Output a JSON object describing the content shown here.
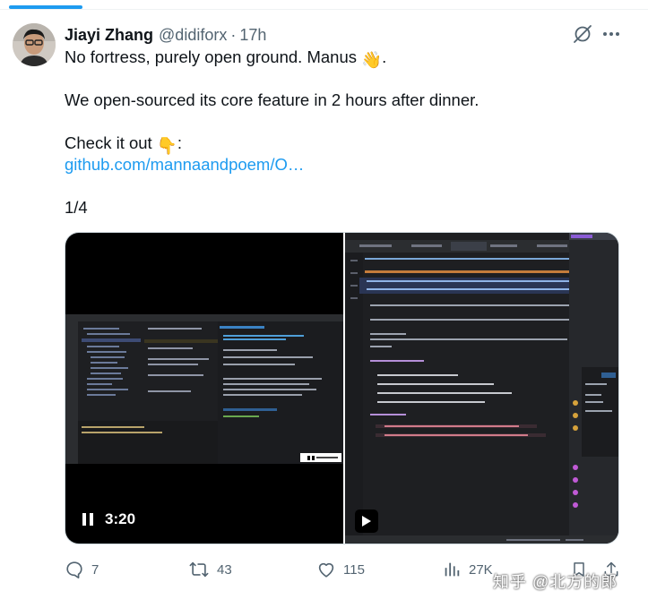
{
  "tweet": {
    "author": {
      "name": "Jiayi Zhang",
      "handle": "@didiforx",
      "separator": "·",
      "time": "17h"
    },
    "lines": {
      "line1_text": "No fortress, purely open ground. Manus ",
      "line1_emoji": "👋",
      "line1_end": ".",
      "line2": "We open-sourced its core feature in 2 hours after dinner.",
      "line3_text": "Check it out ",
      "line3_emoji": "👇",
      "line3_end": ":",
      "link": "github.com/mannaandpoem/O…",
      "counter": "1/4"
    },
    "video": {
      "duration": "3:20"
    },
    "actions": {
      "replies": "7",
      "reposts": "43",
      "likes": "115",
      "views": "27K"
    }
  },
  "icons": {
    "grok": "grok-icon",
    "more": "more-horizontal-icon",
    "reply": "reply-icon",
    "repost": "repost-icon",
    "like": "heart-icon",
    "views": "views-icon",
    "bookmark": "bookmark-icon",
    "share": "share-icon",
    "pause": "pause-icon",
    "play": "play-icon"
  },
  "colors": {
    "link": "#1d9bf0",
    "secondary_text": "#536471",
    "primary_text": "#0f1419"
  },
  "watermark": "知乎 @北方的郎"
}
